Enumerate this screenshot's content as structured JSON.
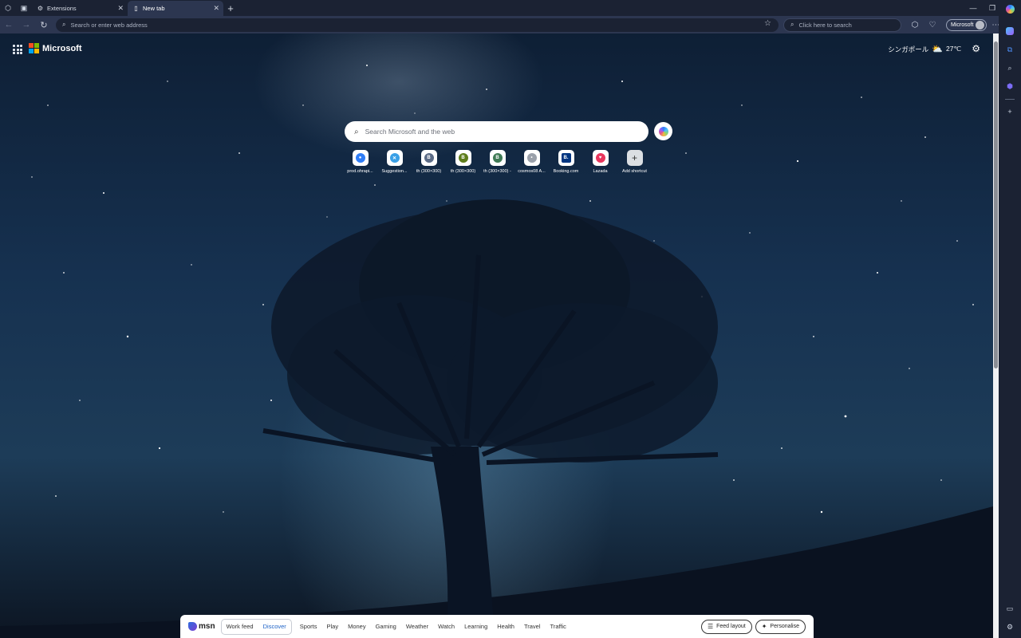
{
  "tabs": [
    {
      "title": "Extensions",
      "active": false
    },
    {
      "title": "New tab",
      "active": true
    }
  ],
  "toolbar": {
    "address_placeholder": "Search or enter web address",
    "search_placeholder": "Click here to search",
    "profile_name": "Microsoft"
  },
  "page": {
    "brand": "Microsoft",
    "weather_location": "シンガポール",
    "weather_temp": "27℃",
    "search_placeholder": "Search Microsoft and the web"
  },
  "shortcuts": [
    {
      "label": "prod.ohrapi...",
      "glyph": "●",
      "color": "#2f7df6"
    },
    {
      "label": "Suggestion...",
      "glyph": "✕",
      "color": "#3aa0e6"
    },
    {
      "label": "th (300×300)",
      "glyph": "B",
      "color": "#5b6b86"
    },
    {
      "label": "th (300×300)",
      "glyph": "B",
      "color": "#5e7d1c"
    },
    {
      "label": "th (300×300) -",
      "glyph": "B",
      "color": "#3f7a55"
    },
    {
      "label": "cosmos08 A...",
      "glyph": "•",
      "color": "#9aa0aa"
    },
    {
      "label": "Booking.com",
      "glyph": "B.",
      "color": "#003580"
    },
    {
      "label": "Lazada",
      "glyph": "♥",
      "color": "#e8365d"
    }
  ],
  "add_shortcut_label": "Add shortcut",
  "feed": {
    "brand": "msn",
    "work_feed": "Work feed",
    "discover": "Discover",
    "items": [
      "Sports",
      "Play",
      "Money",
      "Gaming",
      "Weather",
      "Watch",
      "Learning",
      "Health",
      "Travel",
      "Traffic"
    ],
    "feed_layout": "Feed layout",
    "personalise": "Personalise"
  }
}
